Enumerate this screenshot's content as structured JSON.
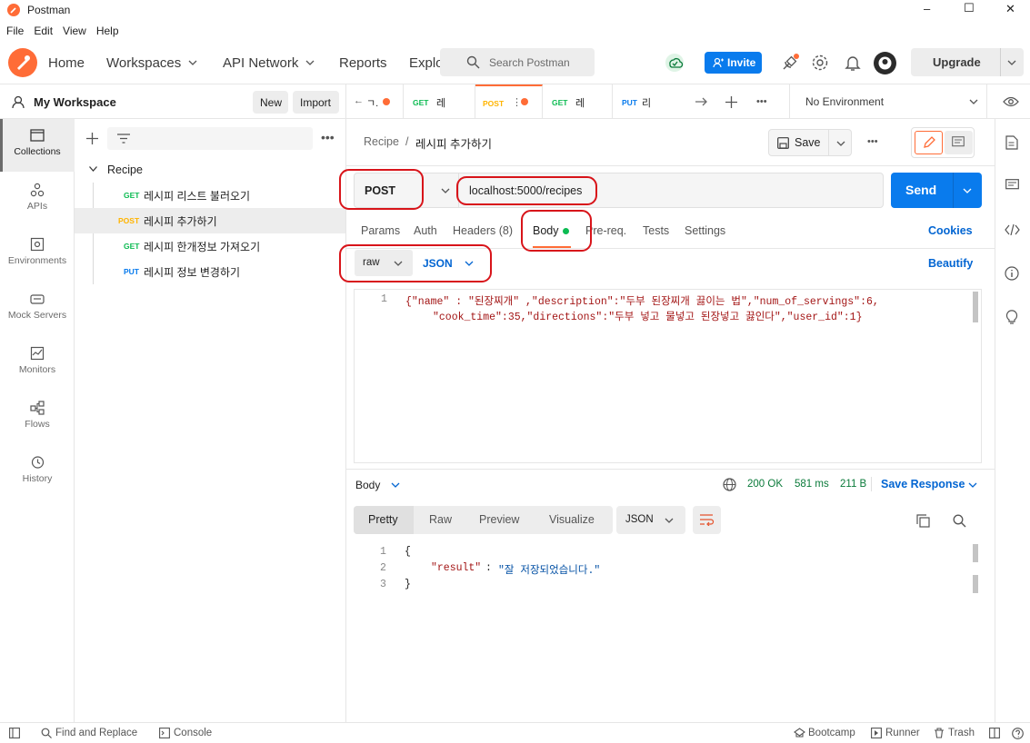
{
  "window": {
    "title": "Postman",
    "controls": [
      "–",
      "☐",
      "✕"
    ]
  },
  "menu": [
    "File",
    "Edit",
    "View",
    "Help"
  ],
  "header": {
    "nav": [
      "Home",
      "Workspaces",
      "API Network",
      "Reports",
      "Explo"
    ],
    "search_placeholder": "Search Postman",
    "invite_label": "Invite",
    "upgrade_label": "Upgrade"
  },
  "workspace": {
    "name": "My Workspace",
    "new_label": "New",
    "import_label": "Import"
  },
  "leftrail": [
    {
      "label": "Collections",
      "icon": "collections-icon"
    },
    {
      "label": "APIs",
      "icon": "apis-icon"
    },
    {
      "label": "Environments",
      "icon": "environments-icon"
    },
    {
      "label": "Mock Servers",
      "icon": "mock-servers-icon"
    },
    {
      "label": "Monitors",
      "icon": "monitors-icon"
    },
    {
      "label": "Flows",
      "icon": "flows-icon"
    },
    {
      "label": "History",
      "icon": "history-icon"
    }
  ],
  "collection": {
    "name": "Recipe",
    "requests": [
      {
        "method": "GET",
        "name": "레시피 리스트 불러오기"
      },
      {
        "method": "POST",
        "name": "레시피 추가하기"
      },
      {
        "method": "GET",
        "name": "레시피 한개정보 가져오기"
      },
      {
        "method": "PUT",
        "name": "레시피 정보 변경하기"
      }
    ]
  },
  "tabs": [
    {
      "method": "",
      "name": "ㄱ."
    },
    {
      "method": "GET",
      "name": "레"
    },
    {
      "method": "POST",
      "name": ""
    },
    {
      "method": "GET",
      "name": "레"
    },
    {
      "method": "PUT",
      "name": "리"
    }
  ],
  "environment": "No Environment",
  "breadcrumb": {
    "collection": "Recipe",
    "separator": "/",
    "request": "레시피 추가하기"
  },
  "save_label": "Save",
  "request": {
    "method": "POST",
    "url": "localhost:5000/recipes",
    "send_label": "Send",
    "subtabs": [
      "Params",
      "Auth",
      "Headers (8)",
      "Body",
      "Pre-req.",
      "Tests",
      "Settings"
    ],
    "cookies_label": "Cookies",
    "body_mode": "raw",
    "body_format": "JSON",
    "beautify_label": "Beautify",
    "body_line_number": "1",
    "body_line1": "{\"name\" : \"된장찌개\" ,\"description\":\"두부 된장찌개 끓이는 법\",\"num_of_servings\":6,",
    "body_line2": "\"cook_time\":35,\"directions\":\"두부 넣고 물넣고 된장넣고 끓인다\",\"user_id\":1}"
  },
  "response": {
    "section_label": "Body",
    "status": "200 OK",
    "time": "581 ms",
    "size": "211 B",
    "save_response_label": "Save Response",
    "views": [
      "Pretty",
      "Raw",
      "Preview",
      "Visualize"
    ],
    "format": "JSON",
    "line_numbers": [
      "1",
      "2",
      "3"
    ],
    "open_brace": "{",
    "result_key": "\"result\"",
    "colon": ":",
    "result_value": "\"잘 저장되었습니다.\"",
    "close_brace": "}"
  },
  "statusbar": {
    "find_replace": "Find and Replace",
    "console": "Console",
    "bootcamp": "Bootcamp",
    "runner": "Runner",
    "trash": "Trash"
  },
  "colors": {
    "accent": "#ff6c37",
    "primary": "#097bed",
    "link": "#0265d2",
    "get": "#0cbb52",
    "post": "#ffb400",
    "put": "#097bed",
    "annotation": "#d8141a"
  }
}
